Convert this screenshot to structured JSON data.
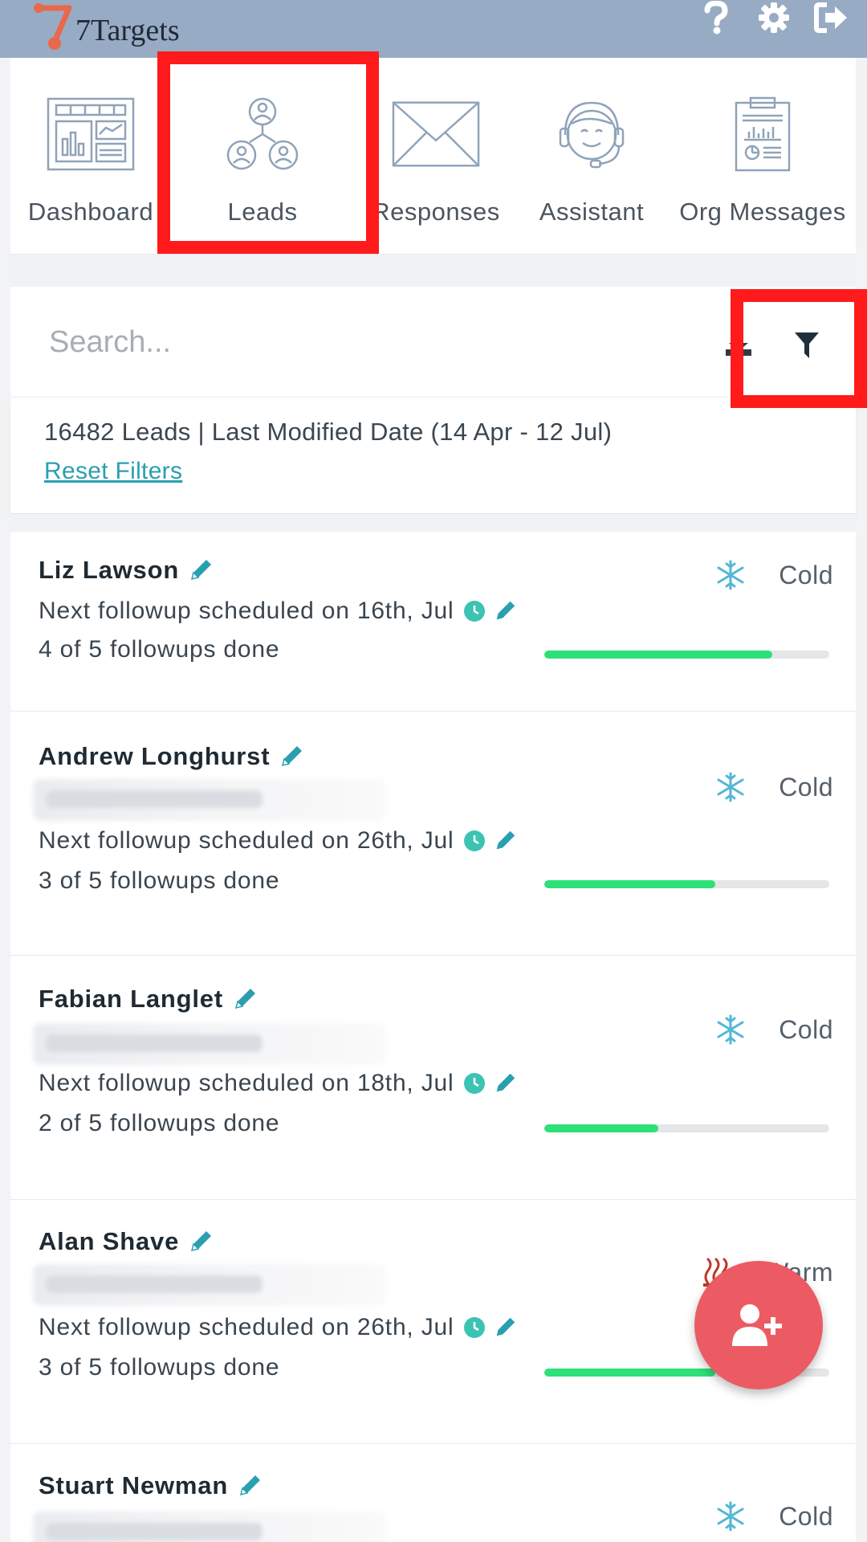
{
  "app": {
    "name": "7Targets"
  },
  "topbar": {
    "help_icon": "help-icon",
    "settings_icon": "gear-icon",
    "logout_icon": "logout-icon"
  },
  "nav": {
    "items": [
      {
        "label": "Dashboard",
        "icon": "dashboard-icon"
      },
      {
        "label": "Leads",
        "icon": "leads-icon"
      },
      {
        "label": "Responses",
        "icon": "envelope-icon"
      },
      {
        "label": "Assistant",
        "icon": "headset-assistant-icon"
      },
      {
        "label": "Org Messages",
        "icon": "clipboard-report-icon"
      }
    ]
  },
  "search": {
    "placeholder": "Search...",
    "value": ""
  },
  "summary": {
    "text": "16482 Leads | Last Modified Date (14 Apr - 12 Jul)",
    "reset_label": "Reset Filters"
  },
  "leads": [
    {
      "name": "Liz Lawson",
      "status": "Cold",
      "status_icon": "snowflake-icon",
      "followup": "Next followup scheduled on 16th, Jul",
      "done": "4 of 5 followups done",
      "progress": 0.8
    },
    {
      "name": "Andrew Longhurst",
      "status": "Cold",
      "status_icon": "snowflake-icon",
      "followup": "Next followup scheduled on 26th, Jul",
      "done": "3 of 5 followups done",
      "progress": 0.6
    },
    {
      "name": "Fabian Langlet",
      "status": "Cold",
      "status_icon": "snowflake-icon",
      "followup": "Next followup scheduled on 18th, Jul",
      "done": "2 of 5 followups done",
      "progress": 0.4
    },
    {
      "name": "Alan Shave",
      "status": "Warm",
      "status_icon": "heat-icon",
      "followup": "Next followup scheduled on 26th, Jul",
      "done": "3 of 5 followups done",
      "progress": 0.6
    },
    {
      "name": "Stuart Newman",
      "status": "Cold",
      "status_icon": "snowflake-icon",
      "followup": "",
      "done": "",
      "progress": 0
    }
  ],
  "colors": {
    "topbar": "#97abc4",
    "accent_teal": "#2a9fb0",
    "progress_green": "#2de078",
    "fab_red": "#ec5b63",
    "highlight_red": "#ff1b1b"
  }
}
